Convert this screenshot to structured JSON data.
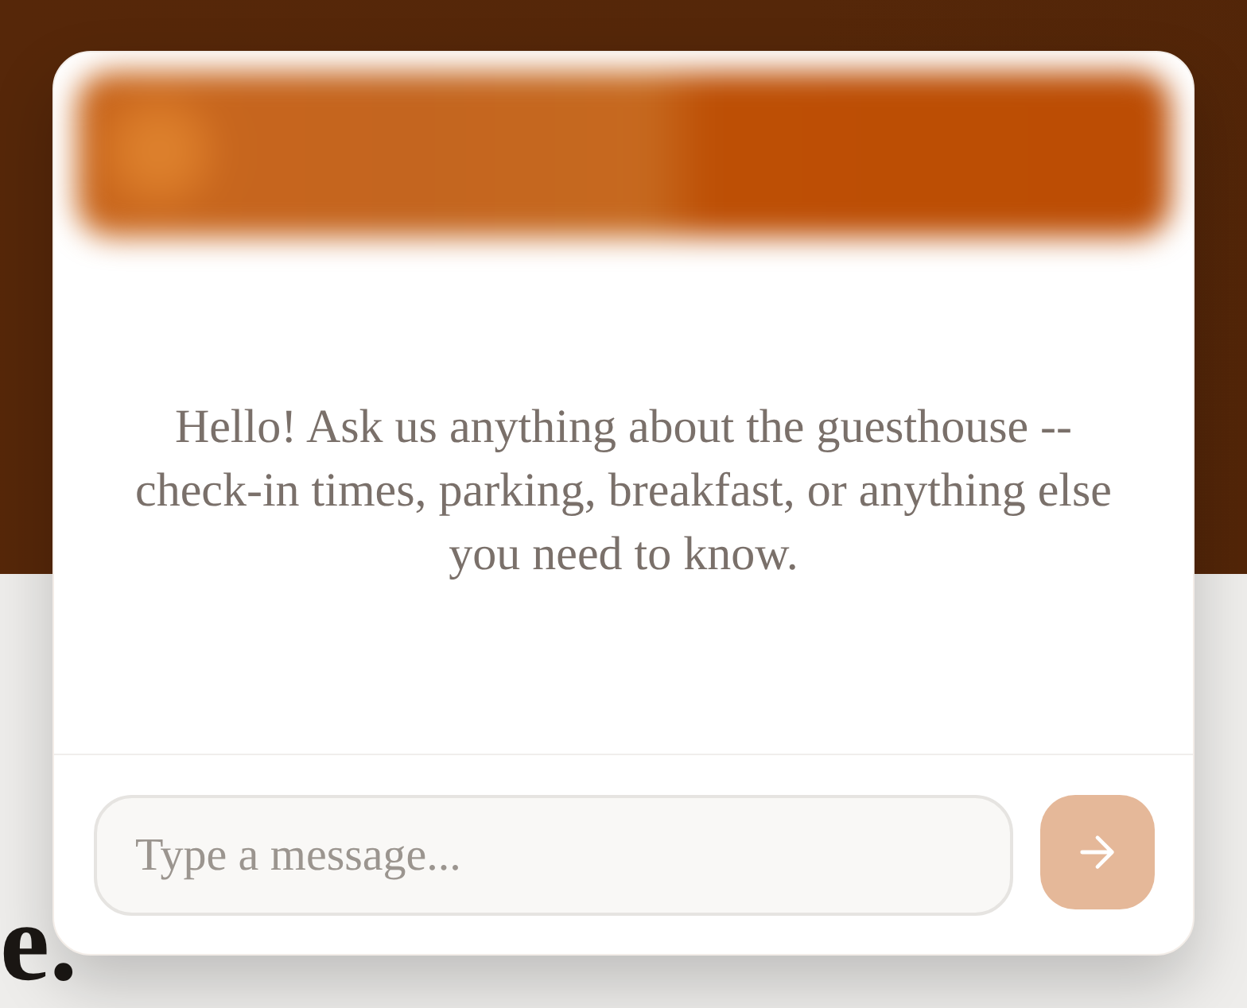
{
  "page": {
    "heading_fragment": "e."
  },
  "chat_widget": {
    "greeting": "Hello! Ask us anything about the guesthouse -- check-in times, parking, breakfast, or anything else you need to know.",
    "composer": {
      "placeholder": "Type a message...",
      "send_button": {
        "disabled": true
      }
    }
  }
}
